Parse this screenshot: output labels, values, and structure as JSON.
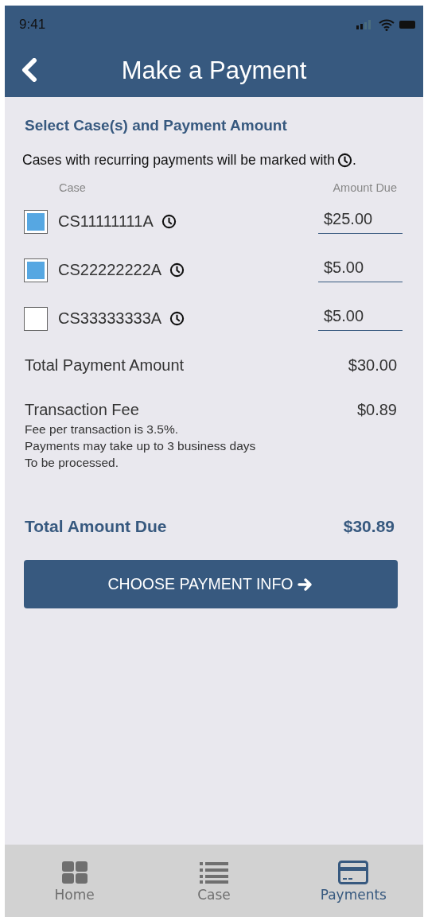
{
  "status_bar": {
    "time": "9:41"
  },
  "header": {
    "title": "Make a Payment"
  },
  "section_title": "Select Case(s) and Payment Amount",
  "note": {
    "text": "Cases with recurring payments will be marked with",
    "suffix": "."
  },
  "columns": [
    "Case",
    "Amount Due"
  ],
  "cases": [
    {
      "number": "CS11111111A",
      "recurring": true,
      "checked": true,
      "amount": "$25.00"
    },
    {
      "number": "CS22222222A",
      "recurring": true,
      "checked": true,
      "amount": "$5.00"
    },
    {
      "number": "CS33333333A",
      "recurring": true,
      "checked": false,
      "amount": "$5.00"
    }
  ],
  "total_payment": {
    "label": "Total Payment Amount",
    "value": "$30.00"
  },
  "fee": {
    "label": "Transaction Fee",
    "value": "$0.89",
    "details": [
      "Fee per transaction is 3.5%.",
      "Payments may take up to 3 business days",
      "To be processed."
    ]
  },
  "total_due": {
    "label": "Total Amount Due",
    "value": "$30.89"
  },
  "action_button": "CHOOSE PAYMENT INFO",
  "tabs": [
    {
      "label": "Home",
      "kind": "grid",
      "selected": false
    },
    {
      "label": "Case",
      "kind": "list",
      "selected": false
    },
    {
      "label": "Payments",
      "kind": "card",
      "selected": true
    }
  ]
}
